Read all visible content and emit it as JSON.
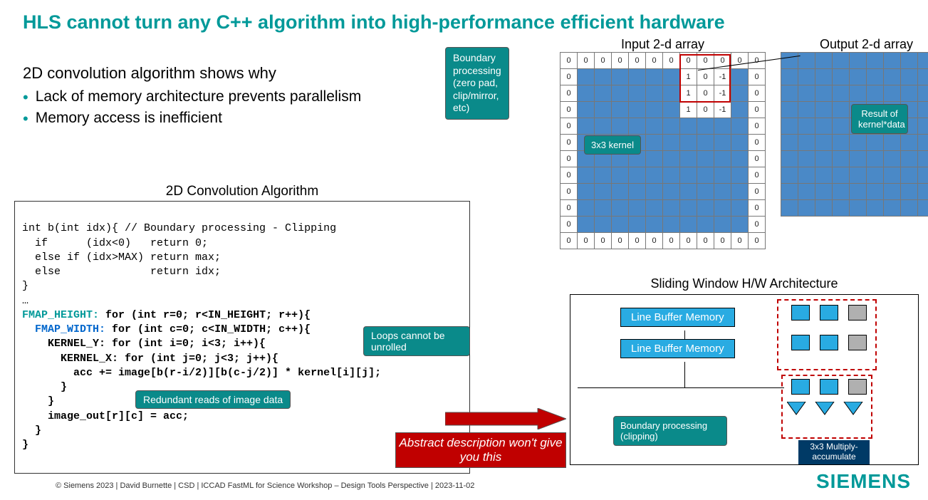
{
  "title": "HLS cannot turn any C++ algorithm into high-performance efficient hardware",
  "subhead": "2D convolution algorithm shows why",
  "bullets": [
    "Lack of memory architecture prevents parallelism",
    "Memory access is inefficient"
  ],
  "code": {
    "title": "2D Convolution Algorithm",
    "line1": "int b(int idx){ // Boundary processing - Clipping",
    "line2": "  if      (idx<0)   return 0;",
    "line3": "  else if (idx>MAX) return max;",
    "line4": "  else              return idx;",
    "line5": "}",
    "line6": "…",
    "label_h": "FMAP_HEIGHT:",
    "loop_h": " for (int r=0; r<IN_HEIGHT; r++){",
    "label_w": "FMAP_WIDTH:",
    "loop_w": " for (int c=0; c<IN_WIDTH; c++){",
    "label_ky": "    KERNEL_Y: for (int i=0; i<3; i++){",
    "label_kx": "      KERNEL_X: for (int j=0; j<3; j++){",
    "acc": "        acc += image[b(r-i/2)][b(c-j/2)] * kernel[i][j];",
    "close1": "      }",
    "close2": "    }",
    "close3": "    image_out[r][c] = acc;",
    "close4": "  }",
    "close5": "}"
  },
  "callouts": {
    "loops": "Loops cannot be unrolled",
    "reads": "Redundant reads of image data",
    "boundary": "Boundary processing (zero pad, clip/mirror, etc)",
    "kernel": "3x3 kernel",
    "result": "Result of kernel*data",
    "clip": "Boundary processing (clipping)",
    "mac": "3x3 Multiply-accumulate"
  },
  "grids": {
    "input_title": "Input 2-d array",
    "output_title": "Output 2-d array",
    "edge_val": "0",
    "kernel_vals": [
      [
        "1",
        "0",
        "-1"
      ],
      [
        "1",
        "0",
        "-1"
      ],
      [
        "1",
        "0",
        "-1"
      ]
    ]
  },
  "sw_title": "Sliding Window H/W Architecture",
  "line_buffer": "Line Buffer Memory",
  "red_warn": "Abstract description won't give you this",
  "footer": "© Siemens 2023 | David Burnette | CSD | ICCAD FastML for Science Workshop – Design Tools Perspective | 2023-11-02",
  "brand": "SIEMENS"
}
